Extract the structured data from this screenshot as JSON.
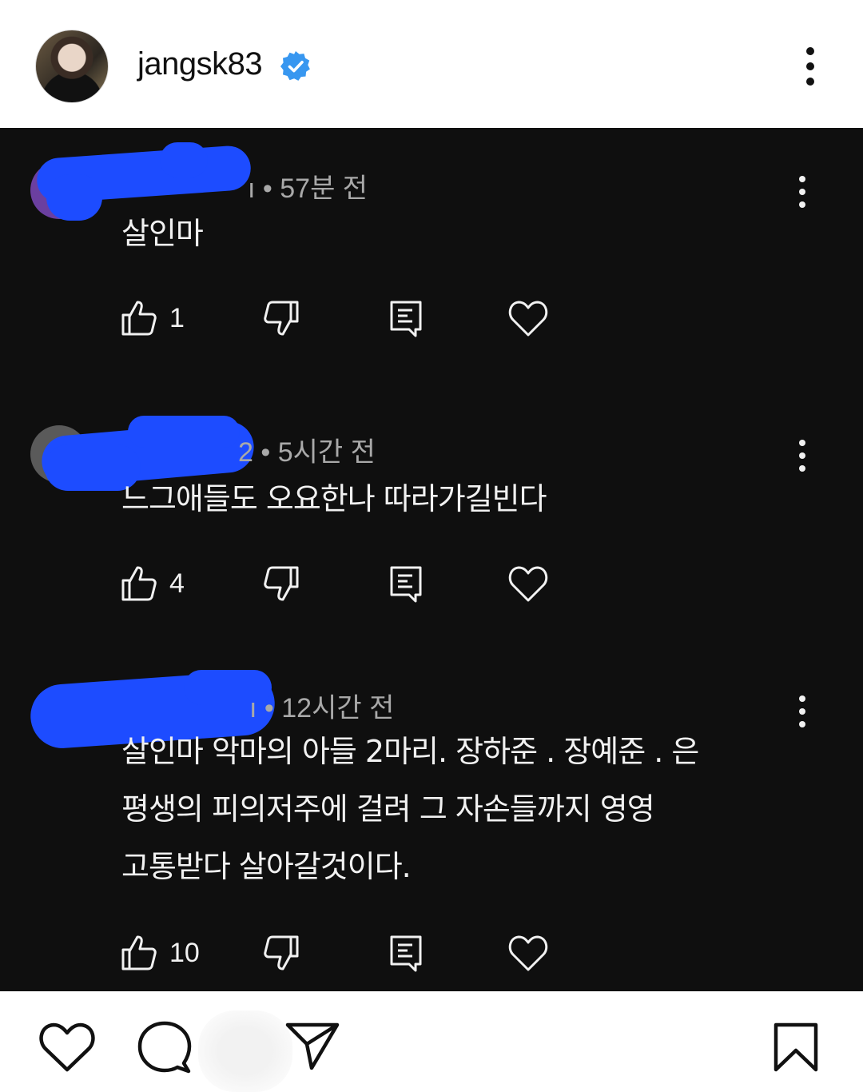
{
  "post": {
    "username": "jangsk83",
    "verified": true,
    "avatar_icon": "profile-photo",
    "more_icon": "more-vertical-icon"
  },
  "colors": {
    "screenshot_bg": "#0f0f0f",
    "redaction": "#1d4cff",
    "verified_badge": "#3897f0",
    "text_light": "#f1f1f1",
    "text_meta": "#a9a9a9"
  },
  "comments": [
    {
      "author_suffix": "ı",
      "time": "• 57분 전",
      "text": "살인마",
      "likes": "1",
      "actions": [
        "thumbs-up-icon",
        "thumbs-down-icon",
        "reply-icon",
        "heart-icon"
      ]
    },
    {
      "author_suffix": "2",
      "time": "• 5시간 전",
      "text": "느그애들도 오요한나 따라가길빈다",
      "likes": "4",
      "actions": [
        "thumbs-up-icon",
        "thumbs-down-icon",
        "reply-icon",
        "heart-icon"
      ]
    },
    {
      "author_suffix": "ı",
      "time": "• 12시간 전",
      "text_lines": [
        "살인마 악마의 아들 2마리. 장하준 . 장예준 . 은",
        "평생의 피의저주에 걸려 그 자손들까지 영영",
        "고통받다 살아갈것이다."
      ],
      "likes": "10",
      "actions": [
        "thumbs-up-icon",
        "thumbs-down-icon",
        "reply-icon",
        "heart-icon"
      ]
    }
  ],
  "post_actions": [
    "heart-icon",
    "comment-icon",
    "share-icon",
    "bookmark-icon"
  ]
}
